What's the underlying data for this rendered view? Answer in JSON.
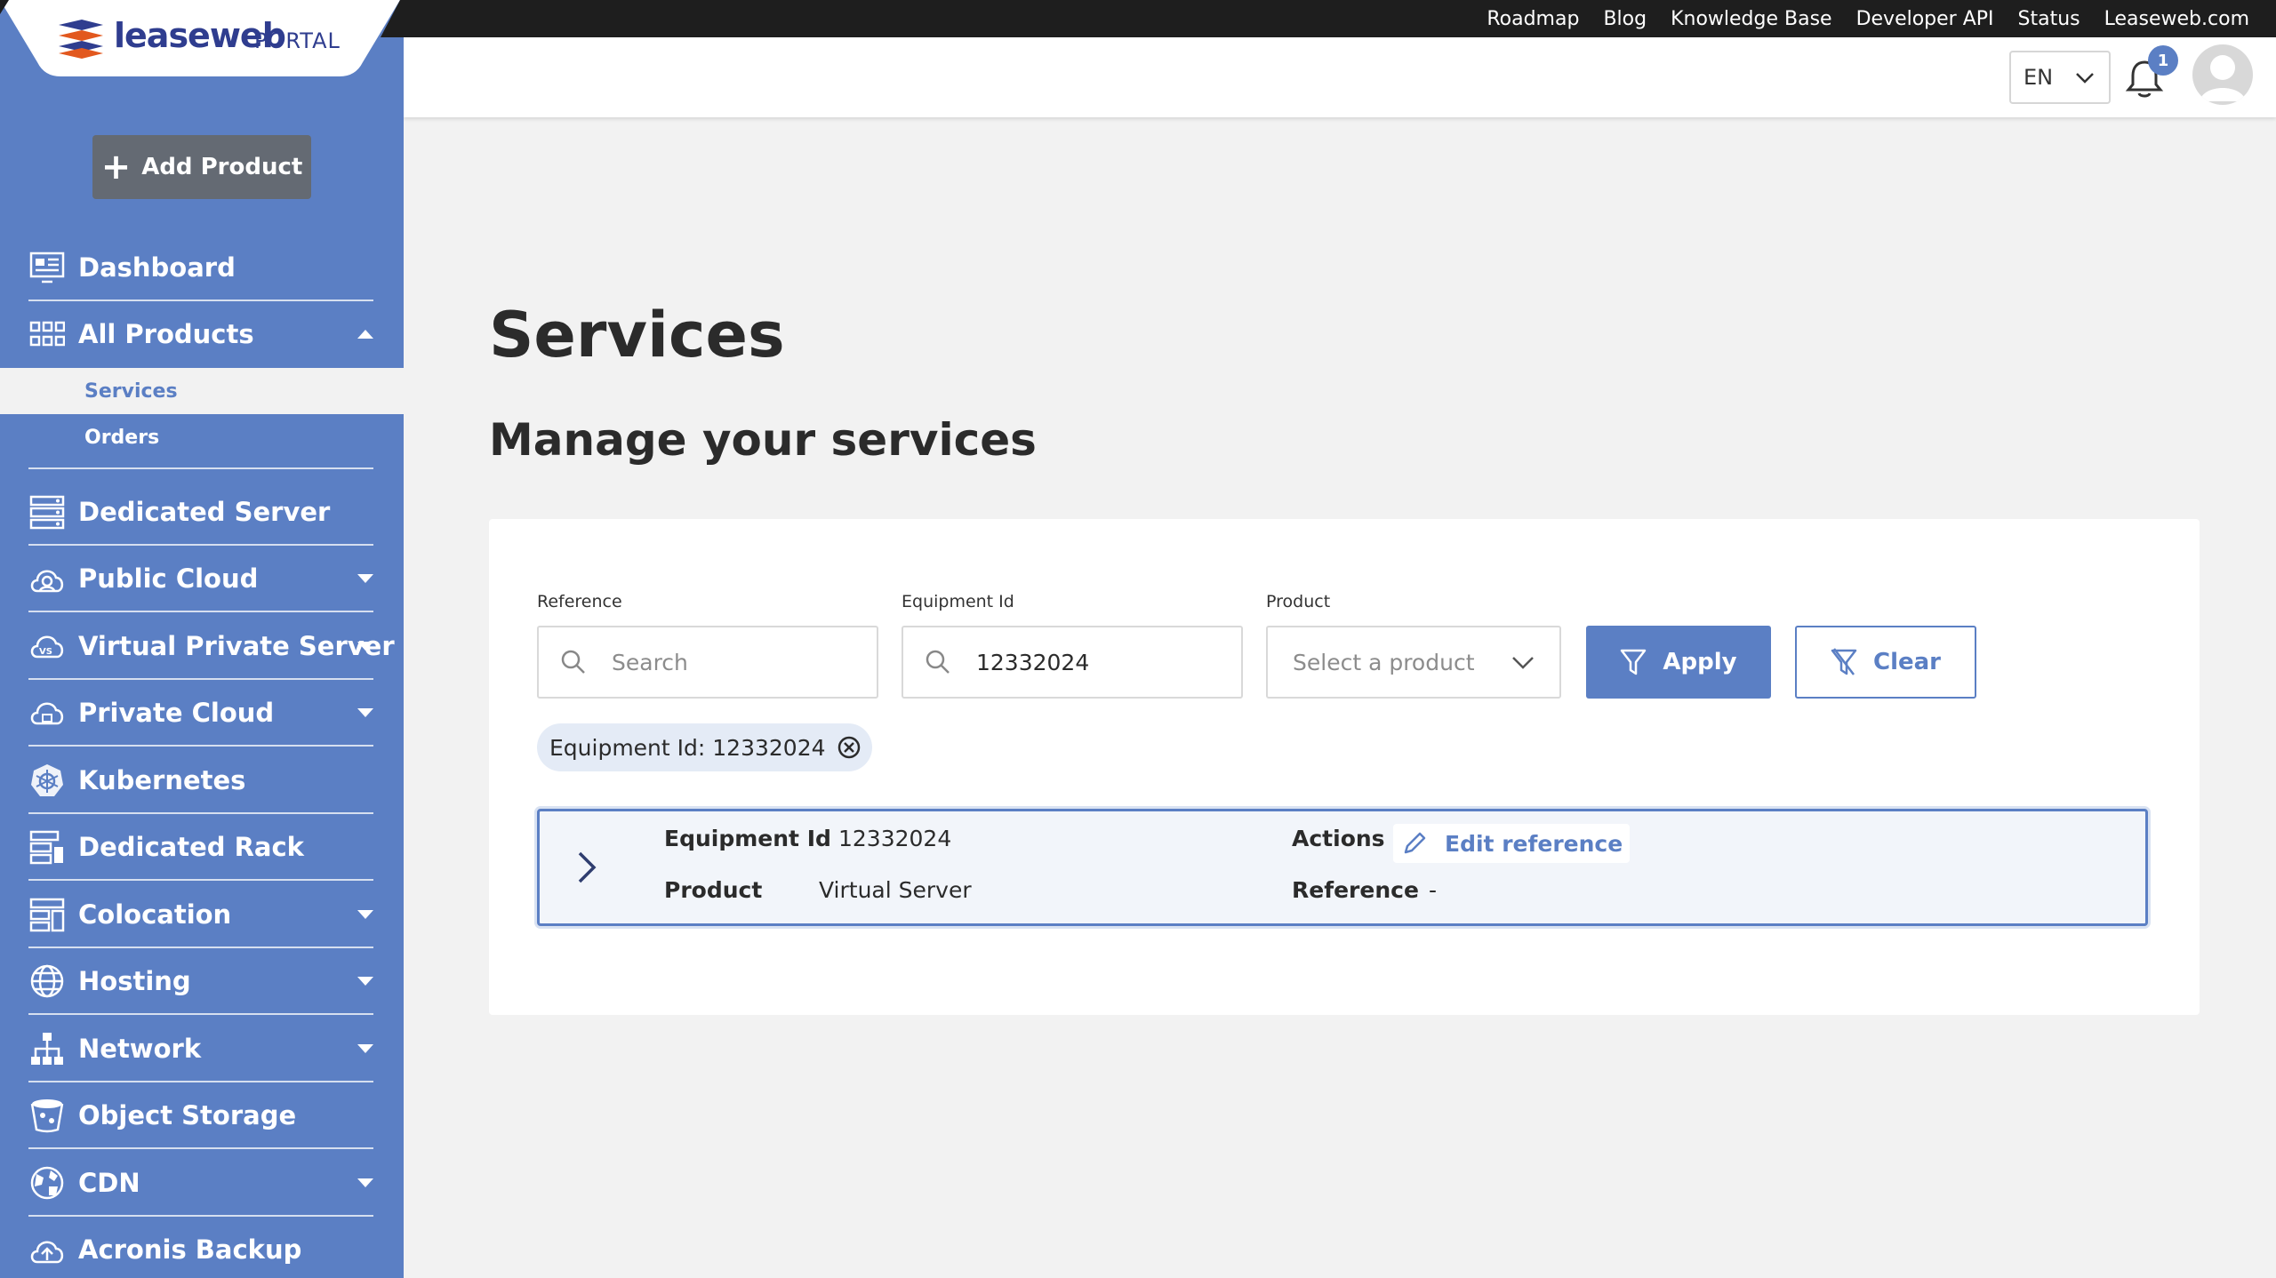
{
  "topbar": {
    "links": [
      "Roadmap",
      "Blog",
      "Knowledge Base",
      "Developer API",
      "Status",
      "Leaseweb.com"
    ]
  },
  "logo": {
    "brand": "leaseweb",
    "portal": "PORTAL"
  },
  "sidebar": {
    "add_product": "Add Product",
    "items": [
      {
        "label": "Dashboard",
        "icon": "dashboard-icon",
        "caret": ""
      },
      {
        "label": "All Products",
        "icon": "grid-icon",
        "caret": "up"
      },
      {
        "label": "Dedicated Server",
        "icon": "server-icon",
        "caret": ""
      },
      {
        "label": "Public Cloud",
        "icon": "public-cloud-icon",
        "caret": "down"
      },
      {
        "label": "Virtual Private Server",
        "icon": "vps-icon",
        "caret": "down"
      },
      {
        "label": "Private Cloud",
        "icon": "private-cloud-icon",
        "caret": "down"
      },
      {
        "label": "Kubernetes",
        "icon": "kubernetes-icon",
        "caret": ""
      },
      {
        "label": "Dedicated Rack",
        "icon": "rack-icon",
        "caret": ""
      },
      {
        "label": "Colocation",
        "icon": "colocation-icon",
        "caret": "down"
      },
      {
        "label": "Hosting",
        "icon": "globe-icon",
        "caret": "down"
      },
      {
        "label": "Network",
        "icon": "network-icon",
        "caret": "down"
      },
      {
        "label": "Object Storage",
        "icon": "bucket-icon",
        "caret": ""
      },
      {
        "label": "CDN",
        "icon": "cdn-icon",
        "caret": "down"
      },
      {
        "label": "Acronis Backup",
        "icon": "backup-icon",
        "caret": ""
      }
    ],
    "sub_items": [
      {
        "label": "Services",
        "active": true
      },
      {
        "label": "Orders",
        "active": false
      }
    ]
  },
  "header": {
    "language": "EN",
    "notifications": "1"
  },
  "main": {
    "title": "Services",
    "subtitle": "Manage your services",
    "filters": {
      "reference_label": "Reference",
      "reference_placeholder": "Search",
      "equipment_label": "Equipment Id",
      "equipment_value": "12332024",
      "product_label": "Product",
      "product_placeholder": "Select a product",
      "apply": "Apply",
      "clear": "Clear"
    },
    "chip": "Equipment Id: 12332024",
    "result": {
      "equipment_key": "Equipment Id",
      "equipment_value": "12332024",
      "product_key": "Product",
      "product_value": "Virtual Server",
      "actions_key": "Actions",
      "edit_reference": "Edit reference",
      "reference_key": "Reference",
      "reference_value": "-"
    }
  },
  "colors": {
    "brand": "#5b7fc4",
    "topbar": "#1e1e1e",
    "logo": "#2f3d8f",
    "accent_orange": "#e2581e"
  }
}
